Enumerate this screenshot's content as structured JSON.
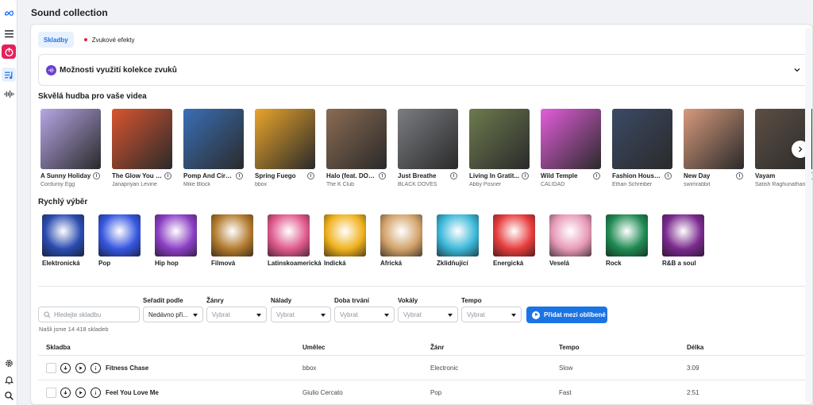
{
  "header": {
    "title": "Sound collection"
  },
  "tabs": [
    {
      "label": "Skladby",
      "active": true
    },
    {
      "label": "Zvukové efekty",
      "active": false
    }
  ],
  "usage": {
    "label": "Možnosti využití kolekce zvuků"
  },
  "music_section": {
    "title": "Skvělá hudba pro vaše videa",
    "items": [
      {
        "title": "A Sunny Holiday",
        "artist": "Corduroy Egg",
        "color": "#b7a6e6"
      },
      {
        "title": "The Glow You K...",
        "artist": "Janapriyan Levine",
        "color": "#d8552f"
      },
      {
        "title": "Pomp And Circ...",
        "artist": "Mike Block",
        "color": "#3a6fb6"
      },
      {
        "title": "Spring Fuego",
        "artist": "bbox",
        "color": "#e9a52b"
      },
      {
        "title": "Halo (feat. DOSE)",
        "artist": "The K Club",
        "color": "#8a6c52"
      },
      {
        "title": "Just Breathe",
        "artist": "BLACK DOVES",
        "color": "#7b7d82"
      },
      {
        "title": "Living In Gratit...",
        "artist": "Abby Posner",
        "color": "#6d7b4e"
      },
      {
        "title": "Wild Temple",
        "artist": "CALIDAD",
        "color": "#e35ddc"
      },
      {
        "title": "Fashion House ...",
        "artist": "Ethan Schreiber",
        "color": "#3b4a66"
      },
      {
        "title": "New Day",
        "artist": "swimrabbit",
        "color": "#d89a7c"
      },
      {
        "title": "Vayam",
        "artist": "Satish Raghunathan",
        "color": "#5d4f44"
      }
    ]
  },
  "quick_section": {
    "title": "Rychlý výběr",
    "items": [
      {
        "label": "Elektronická",
        "color": "#2a4bb0"
      },
      {
        "label": "Pop",
        "color": "#3656e0"
      },
      {
        "label": "Hip hop",
        "color": "#8b3ec4"
      },
      {
        "label": "Filmová",
        "color": "#b27b2e"
      },
      {
        "label": "Latinskoamerická",
        "color": "#e0598d"
      },
      {
        "label": "Indická",
        "color": "#f0b21e"
      },
      {
        "label": "Africká",
        "color": "#d3a36b"
      },
      {
        "label": "Zklidňující",
        "color": "#3bb8d8"
      },
      {
        "label": "Energická",
        "color": "#e73c3c"
      },
      {
        "label": "Veselá",
        "color": "#e79ab8"
      },
      {
        "label": "Rock",
        "color": "#1f8a53"
      },
      {
        "label": "R&B a soul",
        "color": "#7a2a8e"
      }
    ]
  },
  "filters": {
    "search_placeholder": "Hledejte skladbu",
    "sort": {
      "label": "Seřadit podle",
      "value": "Nedávno při..."
    },
    "genres": {
      "label": "Žánry",
      "value": "Vybrat"
    },
    "moods": {
      "label": "Nálady",
      "value": "Vybrat"
    },
    "duration": {
      "label": "Doba trvání",
      "value": "Vybrat"
    },
    "vocals": {
      "label": "Vokály",
      "value": "Vybrat"
    },
    "tempo": {
      "label": "Tempo",
      "value": "Vybrat"
    },
    "fav_button": "Přidat mezi oblíbené",
    "count": "Našli jsme 14 418 skladeb"
  },
  "table": {
    "columns": [
      "Skladba",
      "Umělec",
      "Žánr",
      "Tempo",
      "Délka"
    ],
    "rows": [
      {
        "name": "Fitness Chase",
        "artist": "bbox",
        "genre": "Electronic",
        "tempo": "Slow",
        "length": "3:09"
      },
      {
        "name": "Feel You Love Me",
        "artist": "Giulio Cercato",
        "genre": "Pop",
        "tempo": "Fast",
        "length": "2:51"
      }
    ]
  },
  "icons": {
    "rail": [
      "meta-logo-icon",
      "menu-icon",
      "power-icon",
      "music-list-icon",
      "sound-wave-icon",
      "settings-icon",
      "bell-icon",
      "search-icon"
    ]
  },
  "colors": {
    "accent": "#1b74e4",
    "power": "#e4215b",
    "usage_logo": "#6b3fd4"
  }
}
